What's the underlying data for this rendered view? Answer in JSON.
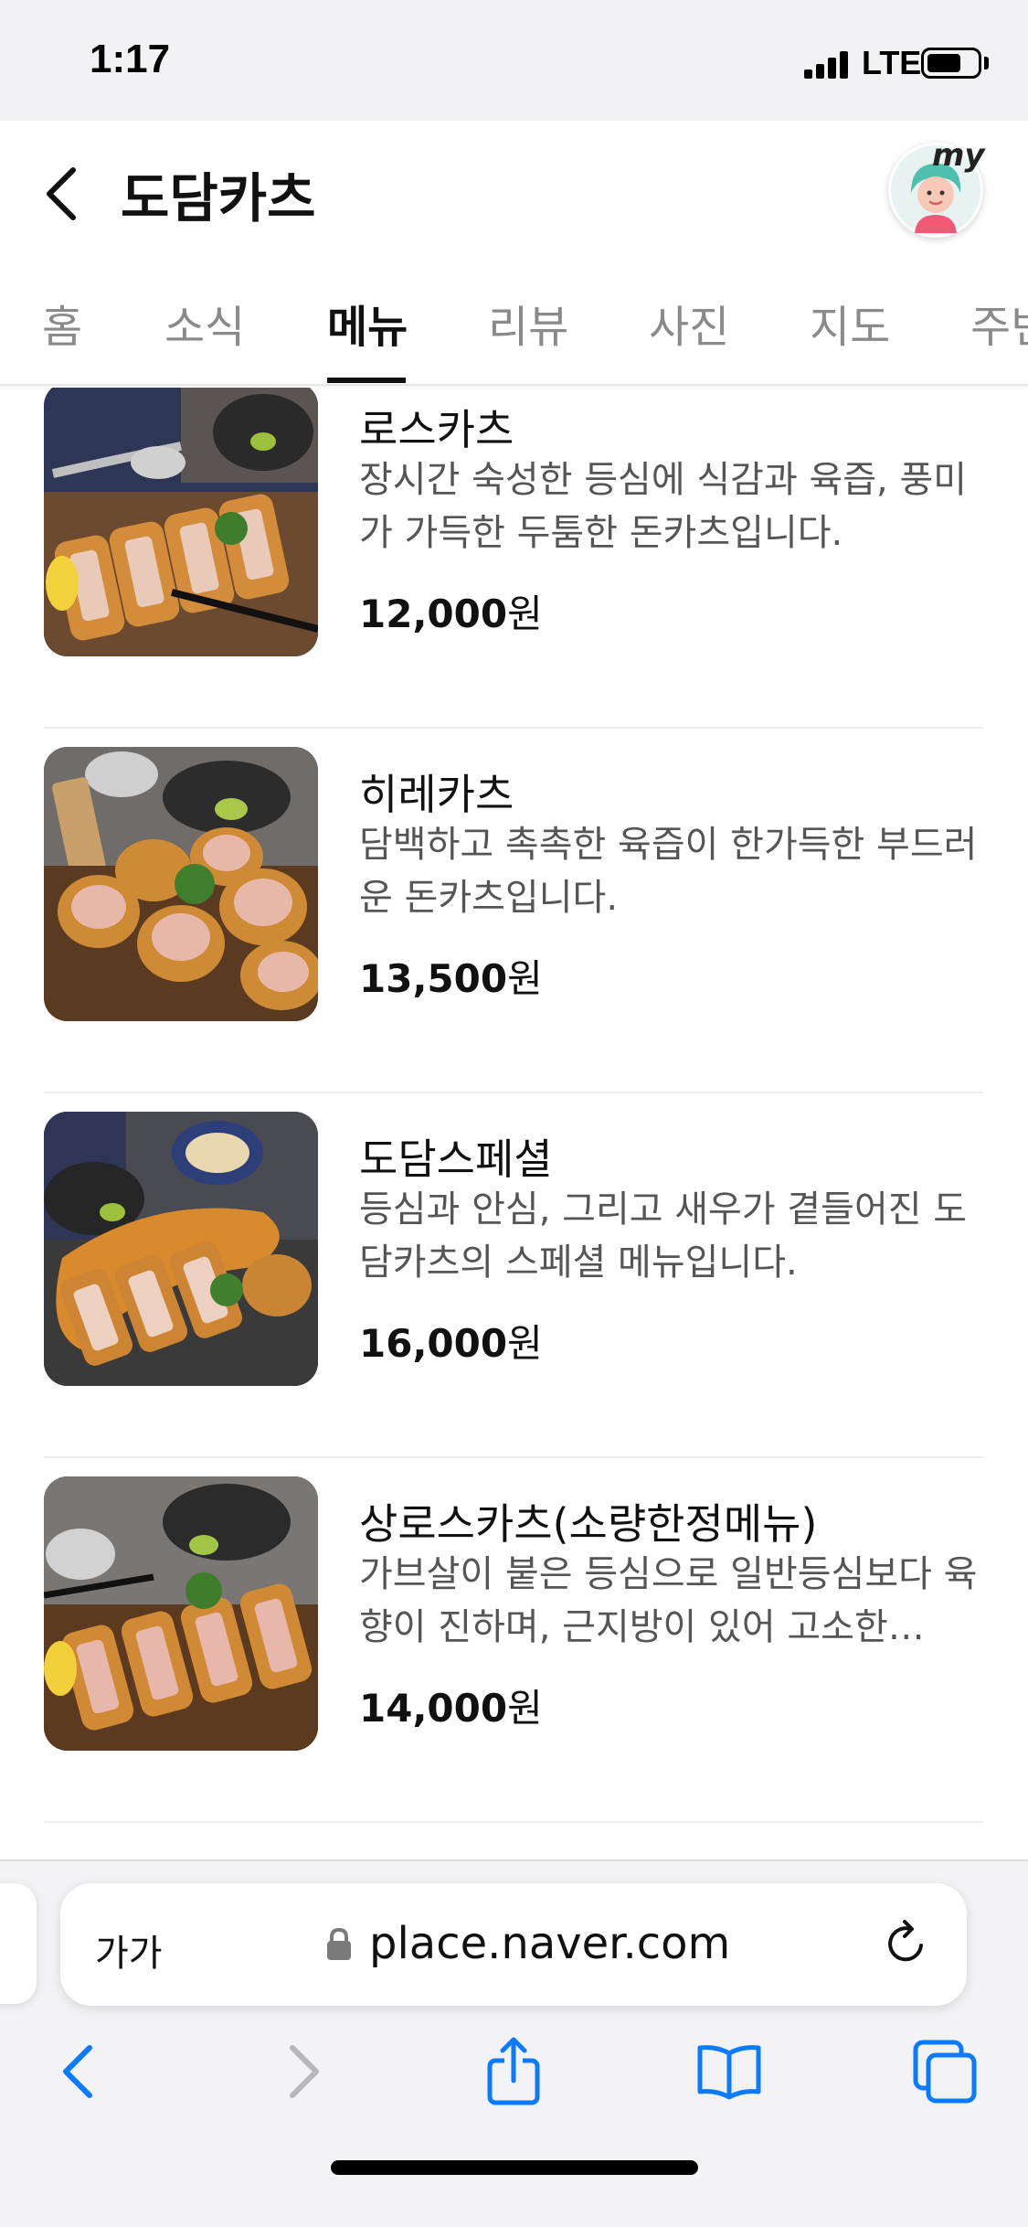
{
  "status_bar": {
    "time": "1:17",
    "network": "LTE"
  },
  "header": {
    "title": "도담카츠",
    "my_badge": "my"
  },
  "tabs": [
    {
      "label": "홈"
    },
    {
      "label": "소식"
    },
    {
      "label": "메뉴"
    },
    {
      "label": "리뷰"
    },
    {
      "label": "사진"
    },
    {
      "label": "지도"
    },
    {
      "label": "주변"
    }
  ],
  "active_tab": "메뉴",
  "menu": {
    "items": [
      {
        "name": "로스카츠",
        "description": "장시간 숙성한 등심에 식감과 육즙, 풍미가 가득한 두툼한 돈카츠입니다.",
        "price_number": "12,000",
        "price_unit": "원"
      },
      {
        "name": "히레카츠",
        "description": "담백하고 촉촉한 육즙이 한가득한 부드러운 돈카츠입니다.",
        "price_number": "13,500",
        "price_unit": "원"
      },
      {
        "name": "도담스페셜",
        "description": "등심과 안심, 그리고 새우가 곁들어진 도담카츠의 스페셜 메뉴입니다.",
        "price_number": "16,000",
        "price_unit": "원"
      },
      {
        "name": "상로스카츠(소량한정메뉴)",
        "description": "가브살이 붙은 등심으로 일반등심보다 육향이 진하며, 근지방이 있어 고소한…",
        "price_number": "14,000",
        "price_unit": "원"
      }
    ]
  },
  "browser": {
    "text_size_button": "가가",
    "url": "place.naver.com"
  },
  "colors": {
    "accent_blue": "#0a7aff",
    "tab_active": "#111111",
    "tab_inactive": "#8a8a8a"
  }
}
